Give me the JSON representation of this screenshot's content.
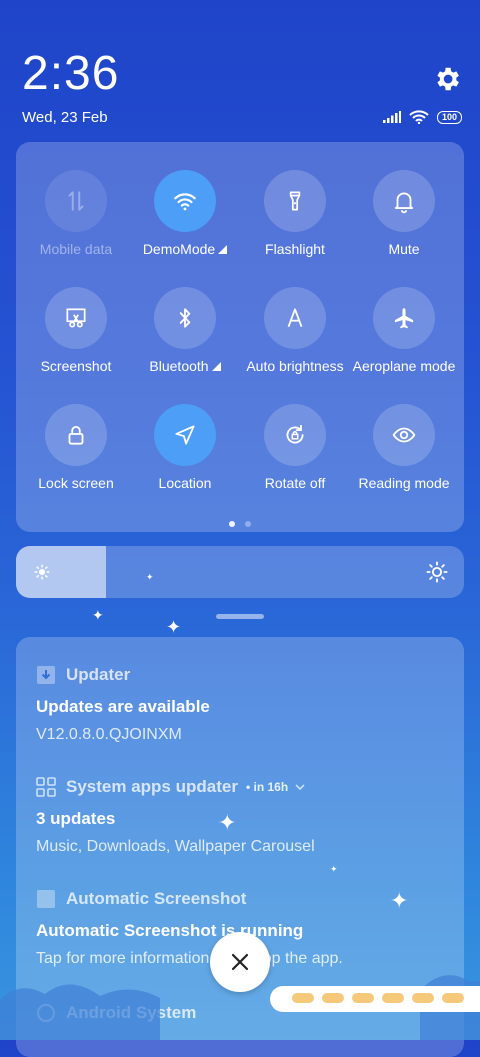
{
  "status_bar": {
    "time": "2:36",
    "date": "Wed, 23 Feb",
    "battery": "100"
  },
  "quick_settings": {
    "tiles": [
      {
        "label": "Mobile data",
        "icon": "mobile-data-icon",
        "state": "disabled"
      },
      {
        "label": "DemoMode",
        "icon": "wifi-icon",
        "state": "active",
        "caret": true
      },
      {
        "label": "Flashlight",
        "icon": "flashlight-icon",
        "state": "off"
      },
      {
        "label": "Mute",
        "icon": "bell-icon",
        "state": "off"
      },
      {
        "label": "Screenshot",
        "icon": "screenshot-icon",
        "state": "off"
      },
      {
        "label": "Bluetooth",
        "icon": "bluetooth-icon",
        "state": "off",
        "caret": true
      },
      {
        "label": "Auto brightness",
        "icon": "auto-brightness-icon",
        "state": "off"
      },
      {
        "label": "Aeroplane mode",
        "icon": "airplane-icon",
        "state": "off"
      },
      {
        "label": "Lock screen",
        "icon": "lock-icon",
        "state": "off"
      },
      {
        "label": "Location",
        "icon": "location-icon",
        "state": "active"
      },
      {
        "label": "Rotate off",
        "icon": "rotate-lock-icon",
        "state": "off"
      },
      {
        "label": "Reading mode",
        "icon": "eye-icon",
        "state": "off"
      }
    ],
    "page": 1,
    "pages": 2
  },
  "brightness": {
    "level": 0.2
  },
  "notifications": [
    {
      "app": "Updater",
      "meta": "",
      "title": "Updates are available",
      "body": "V12.0.8.0.QJOINXM"
    },
    {
      "app": "System apps updater",
      "meta": "• in 16h",
      "title": "3 updates",
      "body": "Music, Downloads, Wallpaper Carousel"
    },
    {
      "app": "Automatic Screenshot",
      "meta": "",
      "title": "Automatic Screenshot is running",
      "body": "Tap for more information or to stop the app."
    },
    {
      "app": "Android System",
      "meta": "",
      "title": "",
      "body": ""
    }
  ],
  "colors": {
    "accent": "#4c9ef6",
    "background_top": "#1f44c9",
    "background_bottom": "#3a94df"
  }
}
